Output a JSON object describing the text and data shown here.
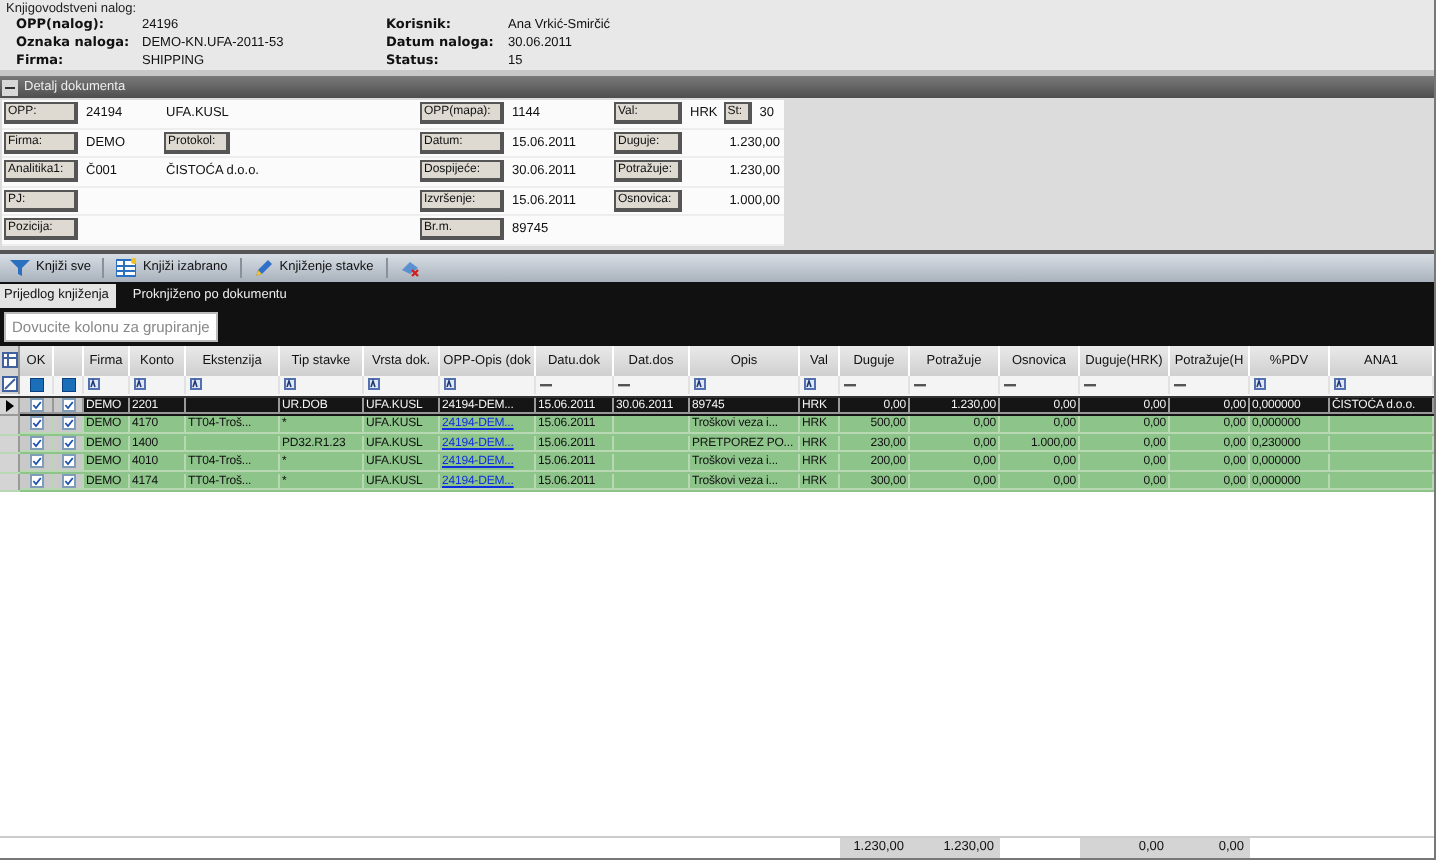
{
  "order": {
    "title": "Knjigovodstveni nalog:",
    "fields": [
      {
        "label": "OPP(nalog):",
        "value": "24196"
      },
      {
        "label": "Korisnik:",
        "value": "Ana Vrkić-Smirčić"
      },
      {
        "label": "Oznaka naloga:",
        "value": "DEMO-KN.UFA-2011-53"
      },
      {
        "label": "Datum naloga:",
        "value": "30.06.2011"
      },
      {
        "label": "Firma:",
        "value": "SHIPPING"
      },
      {
        "label": "Status:",
        "value": "15"
      }
    ]
  },
  "details": {
    "title": "Detalj dokumenta",
    "expanded": true,
    "rows": [
      {
        "left": {
          "label": "OPP:",
          "value": "24194",
          "note": "UFA.KUSL"
        },
        "mid": {
          "label": "OPP(mapa):",
          "value": "1144"
        },
        "right": {
          "label": "Val:",
          "value": "HRK",
          "kind": "text",
          "extra_label": "St:",
          "extra_value": "30"
        }
      },
      {
        "left": {
          "label": "Firma:",
          "value": "DEMO",
          "note_label": "Protokol:"
        },
        "mid": {
          "label": "Datum:",
          "value": "15.06.2011"
        },
        "right": {
          "label": "Duguje:",
          "value": "1.230,00",
          "kind": "amount"
        }
      },
      {
        "left": {
          "label": "Analitika1:",
          "value": "Č001",
          "note": "ČISTOĆA d.o.o."
        },
        "mid": {
          "label": "Dospijeće:",
          "value": "30.06.2011"
        },
        "right": {
          "label": "Potražuje:",
          "value": "1.230,00",
          "kind": "amount"
        }
      },
      {
        "left": {
          "label": "PJ:"
        },
        "mid": {
          "label": "Izvršenje:",
          "value": "15.06.2011"
        },
        "right": {
          "label": "Osnovica:",
          "value": "1.000,00",
          "kind": "amount"
        }
      },
      {
        "left": {
          "label": "Pozicija:"
        },
        "mid": {
          "label": "Br.m.",
          "value": "89745"
        }
      }
    ]
  },
  "toolbar": [
    {
      "kind": "post-all",
      "label": "Knjiži sve"
    },
    {
      "kind": "post-selected",
      "label": "Knjiži izabrano"
    },
    {
      "kind": "edit",
      "label": "Knjiženje stavke"
    },
    {
      "kind": "clear"
    }
  ],
  "tabs": [
    {
      "label": "Prijedlog knjiženja",
      "selected": true
    },
    {
      "label": "Proknjiženo po dokumentu",
      "selected": false
    }
  ],
  "group_panel": {
    "text": "Dovucite kolonu za grupiranje"
  },
  "grid": {
    "check_header": "OK",
    "columns": [
      {
        "title": "Firma",
        "kind": "text"
      },
      {
        "title": "Konto",
        "kind": "text"
      },
      {
        "title": "Ekstenzija",
        "kind": "text"
      },
      {
        "title": "Tip stavke",
        "kind": "text"
      },
      {
        "title": "Vrsta dok.",
        "kind": "text"
      },
      {
        "title": "OPP-Opis (dok",
        "kind": "link"
      },
      {
        "title": "Datu.dok",
        "kind": "date"
      },
      {
        "title": "Dat.dos",
        "kind": "date"
      },
      {
        "title": "Opis",
        "kind": "text"
      },
      {
        "title": "Val",
        "kind": "text"
      },
      {
        "title": "Duguje",
        "kind": "amount",
        "total": "1.230,00"
      },
      {
        "title": "Potražuje",
        "kind": "amount",
        "total": "1.230,00"
      },
      {
        "title": "Osnovica",
        "kind": "amount"
      },
      {
        "title": "Duguje(HRK)",
        "kind": "amount",
        "total": "0,00"
      },
      {
        "title": "Potražuje(H",
        "kind": "amount",
        "total": "0,00"
      },
      {
        "title": "%PDV",
        "kind": "text"
      },
      {
        "title": "ANA1",
        "kind": "text"
      }
    ],
    "rows": [
      {
        "selected": true,
        "checks": [
          true,
          true
        ],
        "cells": [
          "DEMO",
          "2201",
          null,
          "UR.DOB",
          "UFA.KUSL",
          "24194-DEM...",
          "15.06.2011",
          "30.06.2011",
          "89745",
          "HRK",
          "0,00",
          "1.230,00",
          "0,00",
          "0,00",
          "0,00",
          "0,000000",
          "ČISTOĆA d.o.o."
        ]
      },
      {
        "selected": false,
        "checks": [
          true,
          true
        ],
        "cells": [
          "DEMO",
          "4170",
          "TT04-Troš...",
          "*",
          "UFA.KUSL",
          "24194-DEM...",
          "15.06.2011",
          null,
          "Troškovi veza i...",
          "HRK",
          "500,00",
          "0,00",
          "0,00",
          "0,00",
          "0,00",
          "0,000000",
          null
        ]
      },
      {
        "selected": false,
        "checks": [
          true,
          true
        ],
        "cells": [
          "DEMO",
          "1400",
          null,
          "PD32.R1.23",
          "UFA.KUSL",
          "24194-DEM...",
          "15.06.2011",
          null,
          "PRETPOREZ PO...",
          "HRK",
          "230,00",
          "0,00",
          "1.000,00",
          "0,00",
          "0,00",
          "0,230000",
          null
        ]
      },
      {
        "selected": false,
        "checks": [
          true,
          true
        ],
        "cells": [
          "DEMO",
          "4010",
          "TT04-Troš...",
          "*",
          "UFA.KUSL",
          "24194-DEM...",
          "15.06.2011",
          null,
          "Troškovi veza i...",
          "HRK",
          "200,00",
          "0,00",
          "0,00",
          "0,00",
          "0,00",
          "0,000000",
          null
        ]
      },
      {
        "selected": false,
        "checks": [
          true,
          true
        ],
        "cells": [
          "DEMO",
          "4174",
          "TT04-Troš...",
          "*",
          "UFA.KUSL",
          "24194-DEM...",
          "15.06.2011",
          null,
          "Troškovi veza i...",
          "HRK",
          "300,00",
          "0,00",
          "0,00",
          "0,00",
          "0,00",
          "0,000000",
          null
        ]
      }
    ]
  }
}
